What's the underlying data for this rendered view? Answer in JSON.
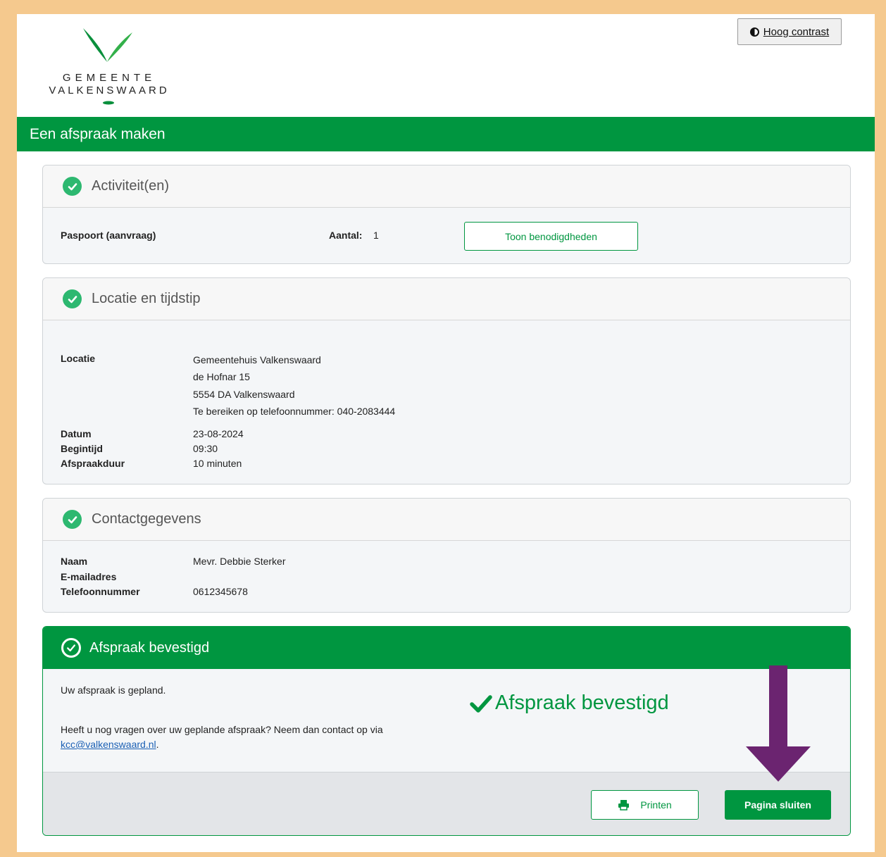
{
  "header": {
    "logo_line1": "GEMEENTE",
    "logo_line2": "VALKENSWAARD",
    "contrast_label": "Hoog contrast"
  },
  "page_title": "Een afspraak maken",
  "activities": {
    "title": "Activiteit(en)",
    "item": "Paspoort (aanvraag)",
    "count_label": "Aantal:",
    "count_value": "1",
    "requirements_button": "Toon benodigdheden"
  },
  "location": {
    "title": "Locatie en tijdstip",
    "location_label": "Locatie",
    "location_lines": [
      "Gemeentehuis Valkenswaard",
      "de Hofnar 15",
      "5554 DA Valkenswaard",
      "Te bereiken op telefoonnummer: 040-2083444"
    ],
    "date_label": "Datum",
    "date_value": "23-08-2024",
    "start_label": "Begintijd",
    "start_value": "09:30",
    "duration_label": "Afspraakduur",
    "duration_value": "10 minuten"
  },
  "contact": {
    "title": "Contactgegevens",
    "name_label": "Naam",
    "name_value": "Mevr. Debbie Sterker",
    "email_label": "E-mailadres",
    "email_value": "",
    "phone_label": "Telefoonnummer",
    "phone_value": "0612345678"
  },
  "confirmation": {
    "title": "Afspraak bevestigd",
    "planned_text": "Uw afspraak is gepland.",
    "question_text": "Heeft u nog vragen over uw geplande afspraak? Neem dan contact op via",
    "email_link": "kcc@valkenswaard.nl",
    "period": ".",
    "badge_text": "Afspraak bevestigd",
    "print_button": "Printen",
    "close_button": "Pagina sluiten"
  },
  "colors": {
    "brand_green": "#009640",
    "check_green": "#2db870",
    "arrow_purple": "#6b2470",
    "frame_orange": "#f5c98e"
  }
}
